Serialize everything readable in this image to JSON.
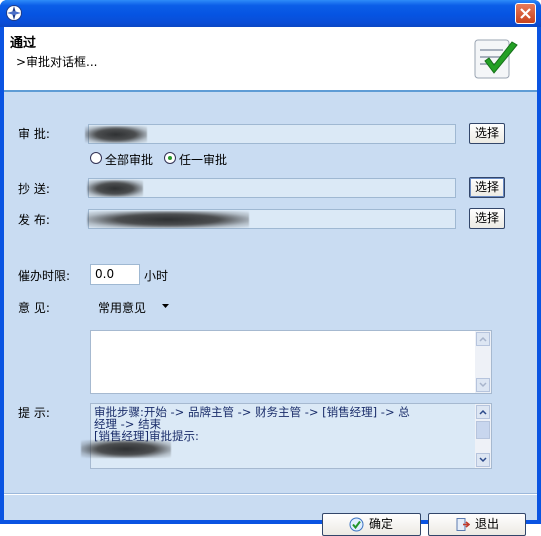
{
  "window": {
    "title": "通过",
    "subtitle": ">审批对话框..."
  },
  "form": {
    "approval": {
      "label": "审    批:",
      "button": "选择"
    },
    "mode": {
      "all_label": "全部审批",
      "any_label": "任一审批",
      "selected": "any"
    },
    "cc": {
      "label": "抄    送:",
      "button": "选择"
    },
    "publish": {
      "label": "发    布:",
      "button": "选择"
    },
    "deadline": {
      "label": "催办时限:",
      "value": "0.0",
      "unit": "小时"
    },
    "opinion": {
      "label": "意    见:",
      "dropdown": "常用意见",
      "text": ""
    },
    "hint": {
      "label": "提    示:",
      "line1": "审批步骤:开始 -> 品牌主管 -> 财务主管 -> [销售经理] -> 总",
      "line2": "经理 -> 结束",
      "line3": "[销售经理]审批提示:"
    }
  },
  "footer": {
    "ok": "确定",
    "exit": "退出"
  },
  "colors": {
    "titlebar": "#0654e2",
    "body": "#c9dcf2",
    "field": "#dbe9f6"
  }
}
